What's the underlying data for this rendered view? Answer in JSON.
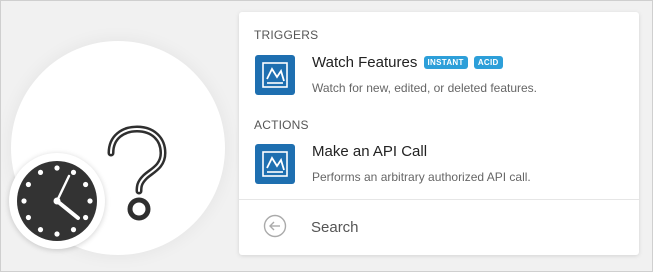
{
  "icons": {
    "question": "question-mark-icon",
    "clock": "clock-icon",
    "app": "app-logo-icon",
    "back": "back-arrow-icon"
  },
  "colors": {
    "app_icon_bg": "#1e6fb0",
    "badge_bg": "#2d9fd9",
    "clock_face": "#333333"
  },
  "sections": {
    "triggers_label": "TRIGGERS",
    "actions_label": "ACTIONS"
  },
  "triggers": [
    {
      "title": "Watch Features",
      "badges": [
        "INSTANT",
        "ACID"
      ],
      "description": "Watch for new, edited, or deleted features."
    }
  ],
  "actions": [
    {
      "title": "Make an API Call",
      "description": "Performs an arbitrary authorized API call."
    }
  ],
  "search": {
    "label": "Search"
  }
}
